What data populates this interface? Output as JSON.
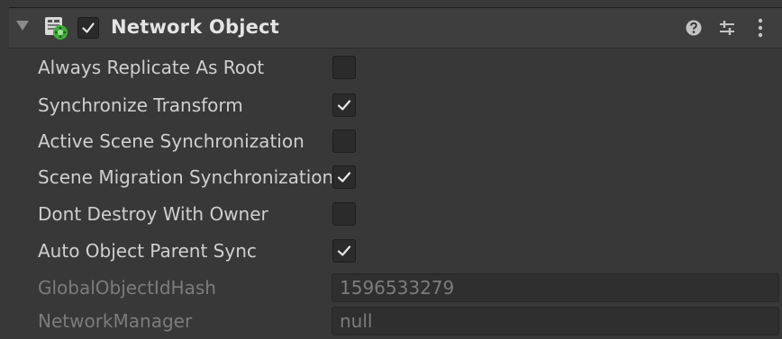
{
  "component": {
    "title": "Network Object",
    "enabled": true,
    "icons": [
      "foldout-arrow-icon",
      "network-object-component-icon",
      "help-icon",
      "preset-settings-icon",
      "kebab-menu-icon"
    ]
  },
  "properties": [
    {
      "label": "Always Replicate As Root",
      "type": "toggle",
      "checked": false
    },
    {
      "label": "Synchronize Transform",
      "type": "toggle",
      "checked": true
    },
    {
      "label": "Active Scene Synchronization",
      "type": "toggle",
      "checked": false
    },
    {
      "label": "Scene Migration Synchronization",
      "type": "toggle",
      "checked": true
    },
    {
      "label": "Dont Destroy With Owner",
      "type": "toggle",
      "checked": false
    },
    {
      "label": "Auto Object Parent Sync",
      "type": "toggle",
      "checked": true
    }
  ],
  "readonly_fields": [
    {
      "label": "GlobalObjectIdHash",
      "value": "1596533279"
    },
    {
      "label": "NetworkManager",
      "value": "null"
    }
  ],
  "colors": {
    "background": "#383838",
    "header": "#3e3e3e",
    "label": "#cfcfcf",
    "disabled_label": "#7c7c7c",
    "checkbox_bg": "#2b2b2b",
    "icon_green": "#3fae3a"
  }
}
